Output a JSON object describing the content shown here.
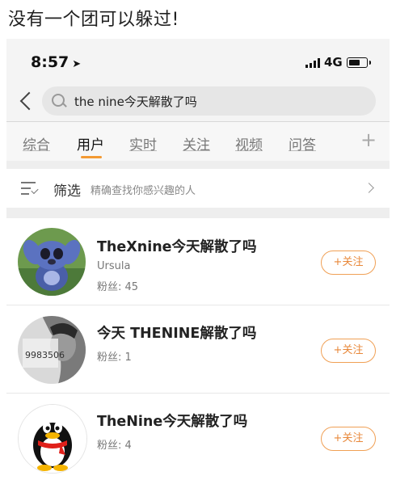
{
  "caption": "没有一个团可以躲过!",
  "status_bar": {
    "time": "8:57",
    "network": "4G",
    "icons": [
      "location-arrow-icon",
      "signal-bars-icon",
      "battery-icon"
    ]
  },
  "search": {
    "query": "the nine今天解散了吗"
  },
  "tabs": [
    {
      "label": "综合",
      "active": false
    },
    {
      "label": "用户",
      "active": true
    },
    {
      "label": "实时",
      "active": false
    },
    {
      "label": "关注",
      "active": false
    },
    {
      "label": "视频",
      "active": false
    },
    {
      "label": "问答",
      "active": false
    }
  ],
  "tab_more": "+",
  "filter": {
    "label": "筛选",
    "hint": "精确查找你感兴趣的人"
  },
  "users": [
    {
      "name": "TheXnine今天解散了吗",
      "subtitle": "Ursula",
      "fans": "粉丝: 45",
      "follow": "+关注"
    },
    {
      "name": "今天 THENINE解散了吗",
      "subtitle": "",
      "fans": "粉丝: 1",
      "follow": "+关注"
    },
    {
      "name": "TheNine今天解散了吗",
      "subtitle": "",
      "fans": "粉丝: 4",
      "follow": "+关注"
    }
  ],
  "avatar_text": {
    "user2": "9983506"
  },
  "colors": {
    "accent": "#f39a33",
    "follow_text": "#e8883a",
    "page_bg": "#eeeeee"
  }
}
